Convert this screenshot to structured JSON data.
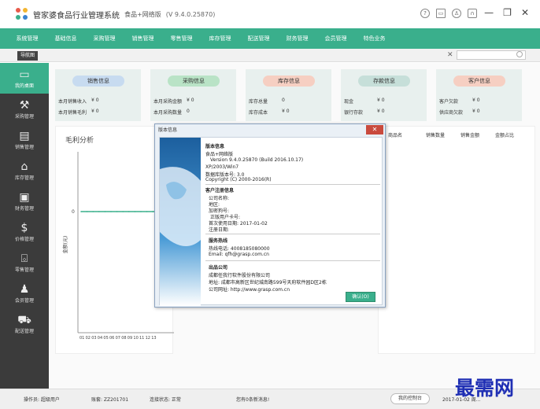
{
  "app": {
    "title": "管家婆食品行业管理系统",
    "edition": "食品+网络版",
    "version": "(V 9.4.0.25870)"
  },
  "title_icons": [
    "help-icon",
    "message-icon",
    "user-icon",
    "lock-icon"
  ],
  "window_controls": [
    "—",
    "❐",
    "✕"
  ],
  "menu": [
    "系统管理",
    "基础信息",
    "采购管理",
    "销售管理",
    "零售管理",
    "库存管理",
    "配送管理",
    "财务管理",
    "会员管理",
    "特色业务"
  ],
  "tabs": {
    "home": "导航图",
    "search_close": "✕",
    "search_placeholder": ""
  },
  "sidebar": [
    {
      "label": "我的桌面",
      "icon": "▭"
    },
    {
      "label": "采购管理",
      "icon": "⚒"
    },
    {
      "label": "销售管理",
      "icon": "▤"
    },
    {
      "label": "库存管理",
      "icon": "⌂"
    },
    {
      "label": "财务管理",
      "icon": "▣"
    },
    {
      "label": "价格管理",
      "icon": "$"
    },
    {
      "label": "零售管理",
      "icon": "⌺"
    },
    {
      "label": "会员管理",
      "icon": "♟"
    },
    {
      "label": "配送管理",
      "icon": "⛟"
    }
  ],
  "cards": [
    {
      "title": "销售信息",
      "rows": [
        {
          "label": "本月销售收入",
          "value": "¥ 0"
        },
        {
          "label": "本月销售毛利",
          "value": "¥ 0"
        }
      ]
    },
    {
      "title": "采购信息",
      "rows": [
        {
          "label": "本月采购金额",
          "value": "¥ 0"
        },
        {
          "label": "本月采购数量",
          "value": "0"
        }
      ]
    },
    {
      "title": "库存信息",
      "rows": [
        {
          "label": "库存总量",
          "value": "0"
        },
        {
          "label": "库存成本",
          "value": "¥ 0"
        }
      ]
    },
    {
      "title": "存款信息",
      "rows": [
        {
          "label": "现金",
          "value": "¥ 0"
        },
        {
          "label": "银行存款",
          "value": "¥ 0"
        }
      ]
    },
    {
      "title": "客户信息",
      "rows": [
        {
          "label": "客户欠款",
          "value": "¥ 0"
        },
        {
          "label": "供应商欠款",
          "value": "¥ 0"
        }
      ]
    }
  ],
  "chart": {
    "title": "毛利分析",
    "ylabel": "金额(元)",
    "y_tick": "0",
    "x_ticks": [
      "01",
      "02",
      "03",
      "04",
      "05",
      "06",
      "07",
      "08",
      "09",
      "10",
      "11",
      "12",
      "13"
    ]
  },
  "chart_data": {
    "type": "line",
    "title": "毛利分析",
    "ylabel": "金额(元)",
    "xlabel": "",
    "categories": [
      "01",
      "02",
      "03",
      "04",
      "05",
      "06",
      "07",
      "08",
      "09",
      "10",
      "11",
      "12",
      "13"
    ],
    "series": [
      {
        "values": [
          0,
          0,
          0,
          0,
          0,
          0,
          0,
          0,
          0,
          0,
          0,
          0,
          0
        ]
      }
    ],
    "ylim": [
      0,
      0
    ],
    "grid": false,
    "color": "#3aaf8c"
  },
  "rank_headers": [
    "商品名",
    "销售数量",
    "销售金额",
    "金额占比"
  ],
  "dialog": {
    "title": "版本信息",
    "close": "✕",
    "section_version": "版本信息",
    "product": "食品+网络版",
    "version_line": "Version 9.4.0.25870 (Build 2016.10.17)",
    "xp_line": "XP/2003/Win7",
    "db_version": "数据库版本号: 3.0",
    "copyright": "Copyright (C) 2000-2016(R)",
    "section_reg": "客户注册信息",
    "reg_company": "公司名称:",
    "reg_area": "地区:",
    "reg_dongle": "加密狗号:",
    "reg_user_card": "正版用户卡号:",
    "reg_first_use": "首次使用日期: 2017-01-02",
    "reg_date": "注册日期:",
    "section_hotline": "服务热线",
    "hotline_phone": "热线电话: 4008185080000",
    "hotline_email": "Email: qfh@grasp.com.cn",
    "section_publisher": "出品公司",
    "pub_company": "成都任我行软件股份有限公司",
    "pub_address": "地址: 成都市高新区世纪城南路599号天府软件园D区2栋",
    "pub_website": "公司网址: http://www.grasp.com.cn",
    "ok": "确认(O)"
  },
  "status": {
    "operator": "操作员: 超级用户",
    "account": "账套: ZZ201701",
    "connection": "连接状态: 正常",
    "messages": "您有0条新消息!",
    "my_console": "我的控制台",
    "date": "2017-01-02 周..."
  },
  "watermark": "最需网",
  "colors": {
    "accent": "#3aaf8c",
    "sidebar": "#3b3b3b"
  }
}
